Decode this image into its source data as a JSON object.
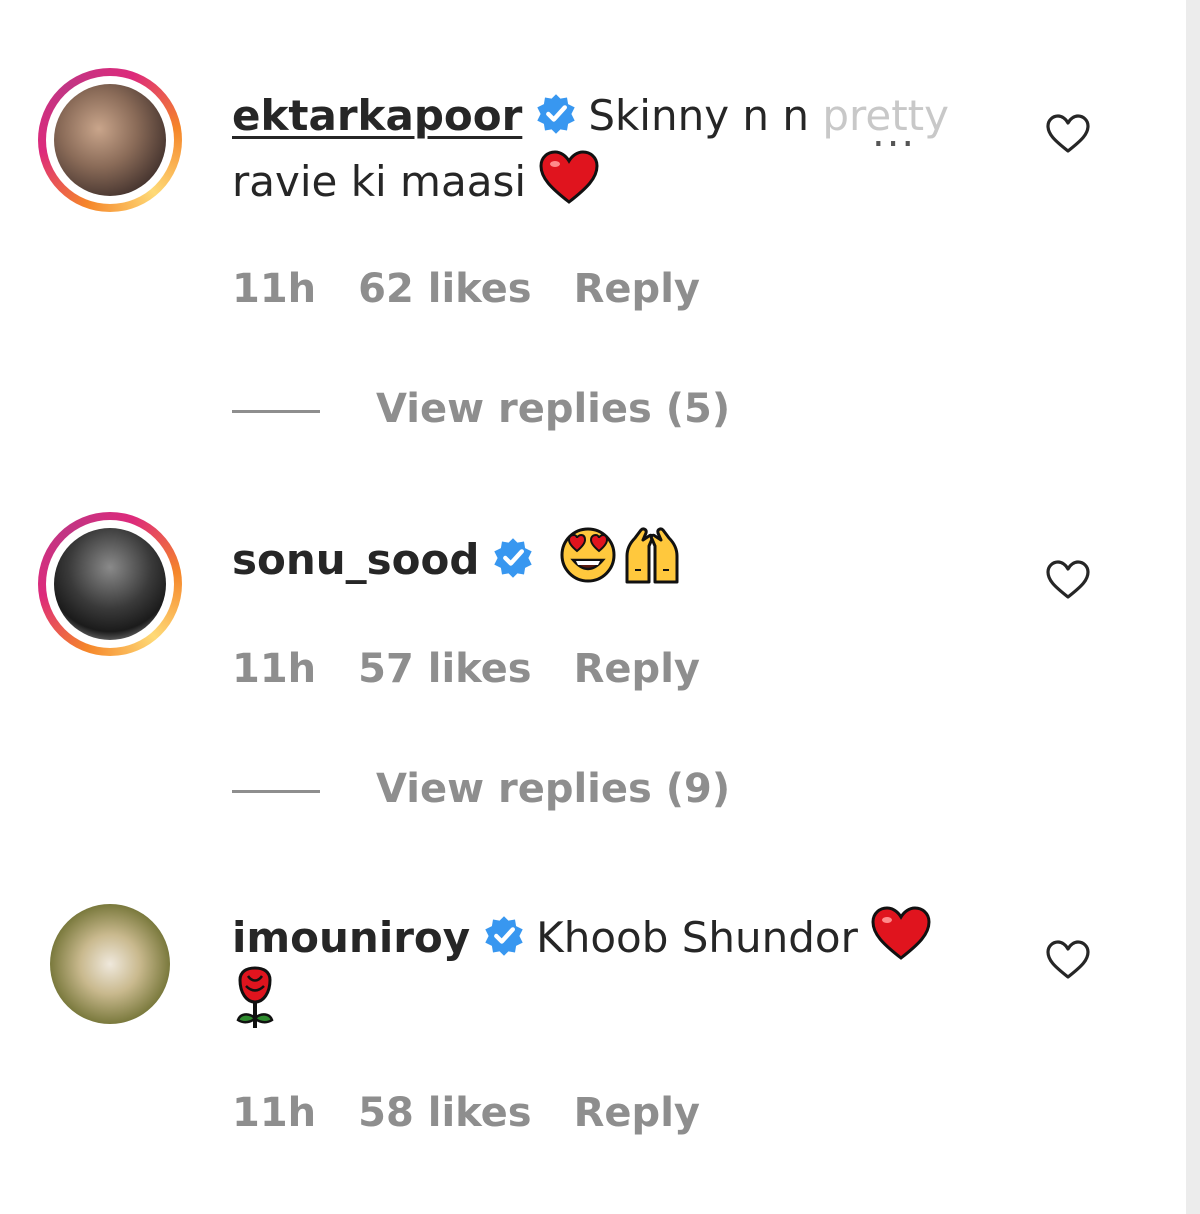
{
  "comments": [
    {
      "username": "ektarkapoor",
      "text_main": "Skinny n n ",
      "text_faded": "pretty",
      "text_line2": "ravie ki maasi",
      "time": "11h",
      "likes": "62 likes",
      "reply": "Reply",
      "view_replies": "View replies (5)"
    },
    {
      "username": "sonu_sood",
      "time": "11h",
      "likes": "57 likes",
      "reply": "Reply",
      "view_replies": "View replies (9)"
    },
    {
      "username": "imouniroy",
      "text_main": "Khoob Shundor",
      "time": "11h",
      "likes": "58 likes",
      "reply": "Reply"
    }
  ],
  "more_indicator": "...",
  "icons": {
    "verified": "verified-badge-icon",
    "like": "heart-outline-icon",
    "red_heart": "red-heart-emoji",
    "heart_eyes": "heart-eyes-emoji",
    "raising_hands": "raising-hands-emoji",
    "rose": "rose-emoji"
  },
  "colors": {
    "verified_blue": "#3897f0",
    "meta_gray": "#8e8e8e",
    "heart_red": "#e0141e"
  }
}
